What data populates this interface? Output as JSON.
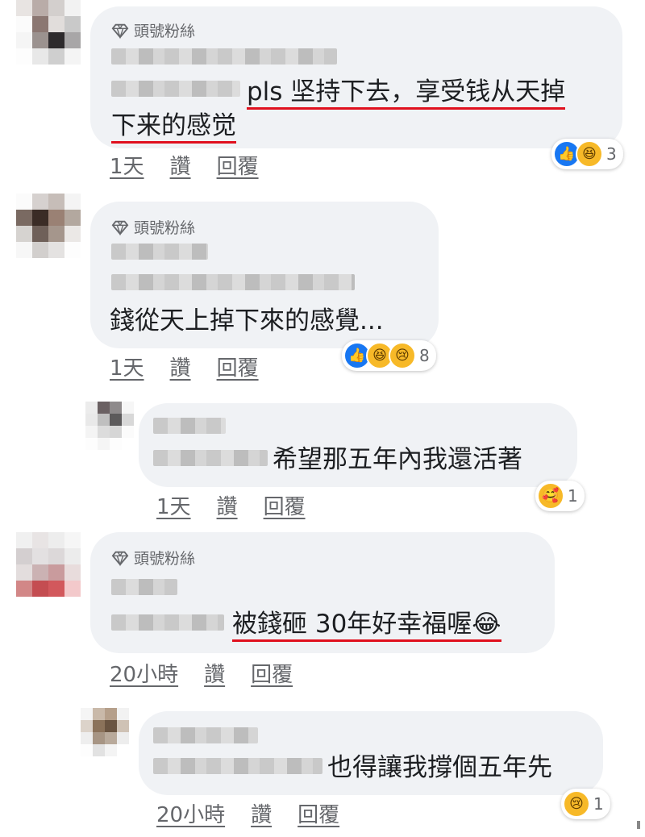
{
  "badge_label": "頭號粉絲",
  "comments": [
    {
      "text_line1": "pls 坚持下去，享受钱从天掉",
      "text_line2": "下来的感觉",
      "time": "1天",
      "like": "讚",
      "reply": "回覆",
      "reactions": [
        "like",
        "haha"
      ],
      "reaction_count": "3"
    },
    {
      "text": "錢從天上掉下來的感覺...",
      "time": "1天",
      "like": "讚",
      "reply": "回覆",
      "reactions": [
        "like",
        "haha",
        "sad"
      ],
      "reaction_count": "8"
    },
    {
      "text": "希望那五年內我還活著",
      "time": "1天",
      "like": "讚",
      "reply": "回覆",
      "reactions": [
        "care"
      ],
      "reaction_count": "1"
    },
    {
      "text": "被錢砸 30年好幸福喔😂",
      "time": "20小時",
      "like": "讚",
      "reply": "回覆"
    },
    {
      "text": "也得讓我撐個五年先",
      "time": "20小時",
      "like": "讚",
      "reply": "回覆",
      "reactions": [
        "sad"
      ],
      "reaction_count": "1"
    }
  ],
  "colors": {
    "bubble": "#f0f2f5",
    "underline": "#e0101e",
    "meta_text": "#65676b",
    "like_blue": "#1877f2",
    "emoji_yellow": "#f7b928"
  },
  "icons": {
    "badge": "diamond-icon",
    "like": "thumbs-up-icon",
    "haha": "laughing-face-icon",
    "sad": "sad-face-icon",
    "care": "care-face-icon"
  }
}
